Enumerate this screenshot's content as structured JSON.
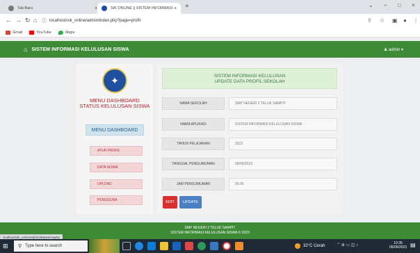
{
  "browser": {
    "tabs": [
      {
        "label": "Tab Baru",
        "close": "×"
      },
      {
        "label": "SIK ONLINE || SISTEM INFORMASI",
        "close": "×"
      }
    ],
    "new_tab": "+",
    "window_controls": [
      "⌄",
      "–",
      "□",
      "×"
    ],
    "url": "localhost/sik_online/admin/index.php?page=profil",
    "bookmarks": [
      {
        "label": "Gmail",
        "color": "#d44638"
      },
      {
        "label": "YouTube",
        "color": "#ff0000"
      },
      {
        "label": "Maps",
        "color": "#34a853"
      }
    ]
  },
  "header": {
    "title": "SISTEM INFORMASI KELULUSAN SISWA",
    "user": "admin ▾"
  },
  "sidebar": {
    "menu_title_line1": "MENU DASHBOARD",
    "menu_title_line2": "STATUS KELULUSAN SISWA",
    "dashboard_label": "MENU DASHBOARD",
    "items": [
      {
        "label": "ATUR PROFIL"
      },
      {
        "label": "DATA SISWA"
      },
      {
        "label": "UPLOAD"
      },
      {
        "label": "PENGGUNA"
      }
    ]
  },
  "main": {
    "alert_line1": "SISTEM INFORMASI KELULUSAN",
    "alert_line2": "UPDATE DATA PROFIL SEKOLAH",
    "fields": [
      {
        "label": "NAMA SEKOLAH",
        "value": "SMP NEGERI 2 TELUK SAMPIT"
      },
      {
        "label": "NAMA APLIKASI",
        "value": "SISTEM INFORMASI KELULUSAN SISWA"
      },
      {
        "label": "TAHUN PELAJARAN",
        "value": "2023"
      },
      {
        "label": "TANGGAL PENGUMUMAN",
        "value": "06/06/2023"
      },
      {
        "label": "JAM PENGUMUMAN",
        "value": "09.00"
      }
    ],
    "edit_label": "EDIT",
    "update_label": "UPDATE"
  },
  "footer": {
    "line1": "SMP NEGERI 2 TELUK SAMPIT",
    "line2": "SISTEM INFORMASI KELULUSAN SISWA © 2023"
  },
  "status_url": "localhost/sik_online/admin/dataseirsaphp",
  "taskbar": {
    "search_placeholder": "Type here to search",
    "weather": "32°C Cerah",
    "time": "10:36",
    "date": "05/06/2023"
  },
  "colors": {
    "header_green": "#3d8b37",
    "menu_red": "#b3202a",
    "edit_red": "#d9302e",
    "update_blue": "#4a7fc1",
    "alert_green_bg": "#dff0d8"
  }
}
